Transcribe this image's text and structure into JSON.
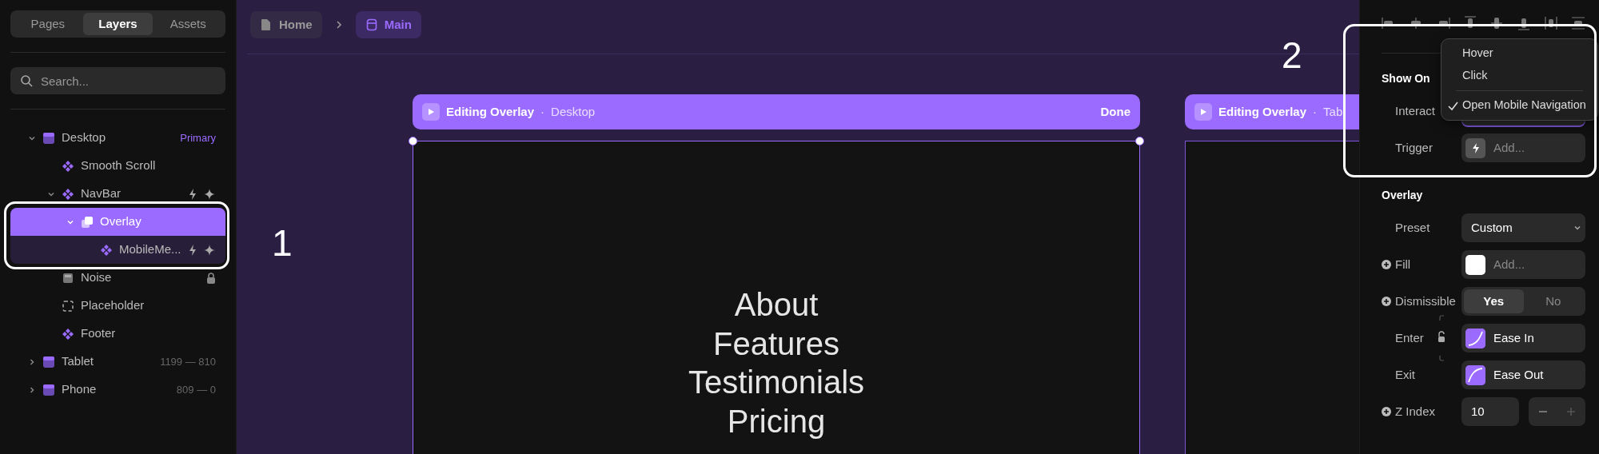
{
  "sidebar": {
    "tabs": [
      {
        "label": "Pages",
        "selected": false
      },
      {
        "label": "Layers",
        "selected": true
      },
      {
        "label": "Assets",
        "selected": false
      }
    ],
    "search": {
      "placeholder": "Search..."
    },
    "layers": [
      {
        "name": "Desktop",
        "kind": "frame",
        "badge": "Primary",
        "expanded": true,
        "children": [
          {
            "name": "Smooth Scroll",
            "kind": "component"
          },
          {
            "name": "NavBar",
            "kind": "component",
            "expanded": true,
            "actions": true,
            "children": [
              {
                "name": "Overlay",
                "kind": "stack",
                "selected": true,
                "expanded": true,
                "children": [
                  {
                    "name": "MobileMe...",
                    "kind": "component",
                    "actions": true
                  }
                ]
              }
            ]
          },
          {
            "name": "Noise",
            "kind": "image",
            "locked": true
          },
          {
            "name": "Placeholder",
            "kind": "placeholder"
          },
          {
            "name": "Footer",
            "kind": "component"
          }
        ]
      },
      {
        "name": "Tablet",
        "kind": "frame",
        "dimensions": "1199 — 810",
        "expanded": false
      },
      {
        "name": "Phone",
        "kind": "frame",
        "dimensions": "809 — 0",
        "expanded": false
      }
    ]
  },
  "breadcrumb": [
    {
      "label": "Home",
      "kind": "page",
      "selected": false
    },
    {
      "label": "Main",
      "kind": "frame",
      "selected": true
    }
  ],
  "frames": [
    {
      "title": "Editing Overlay",
      "separator": "·",
      "device": "Desktop",
      "action": "Done",
      "selected": true,
      "nav_links": [
        "About",
        "Features",
        "Testimonials",
        "Pricing"
      ]
    },
    {
      "title": "Editing Overlay",
      "separator": "·",
      "device": "Tab",
      "selected": false
    }
  ],
  "annotations": [
    {
      "label": "1"
    },
    {
      "label": "2"
    }
  ],
  "properties": {
    "show_on": {
      "heading": "Show On",
      "rows": [
        {
          "label": "Interact",
          "kind": "select",
          "open": true
        },
        {
          "label": "Trigger",
          "kind": "add",
          "placeholder": "Add..."
        }
      ],
      "menu": {
        "groups": [
          [
            {
              "label": "Hover",
              "checked": false
            },
            {
              "label": "Click",
              "checked": false
            }
          ],
          [
            {
              "label": "Open Mobile Navigation",
              "checked": true
            }
          ]
        ]
      }
    },
    "overlay": {
      "heading": "Overlay",
      "easing_locked": false,
      "rows": [
        {
          "label": "Preset",
          "kind": "select",
          "value": "Custom"
        },
        {
          "label": "Fill",
          "kind": "color",
          "add_button": true,
          "color": "#ffffff",
          "placeholder": "Add..."
        },
        {
          "label": "Dismissible",
          "kind": "segmented",
          "add_button": true,
          "options": [
            {
              "label": "Yes",
              "selected": true
            },
            {
              "label": "No",
              "selected": false
            }
          ]
        },
        {
          "label": "Enter",
          "kind": "ease_in",
          "value": "Ease In"
        },
        {
          "label": "Exit",
          "kind": "ease_out",
          "value": "Ease Out"
        },
        {
          "label": "Z Index",
          "kind": "stepper",
          "add_button": true,
          "value": "10"
        }
      ]
    }
  }
}
